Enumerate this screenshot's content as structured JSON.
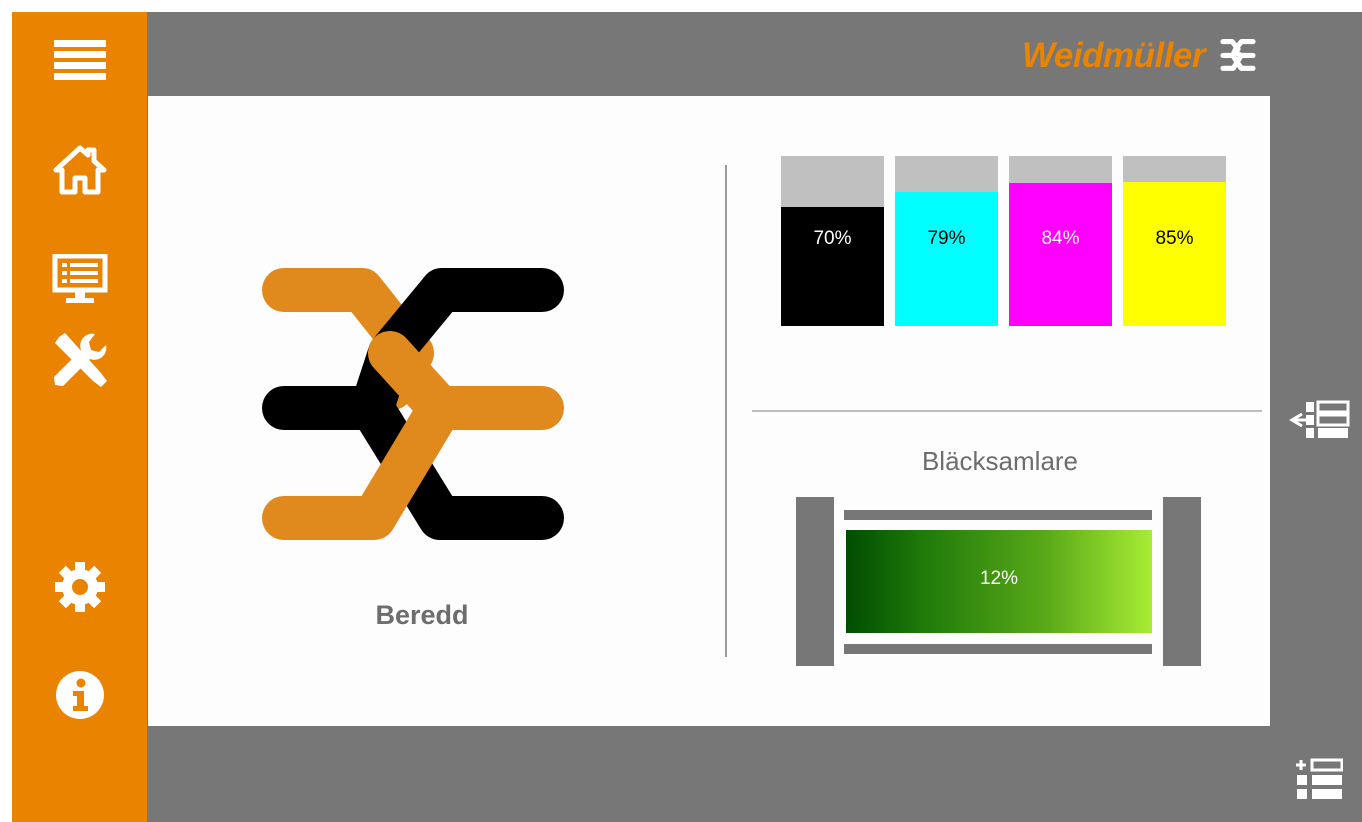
{
  "brand": {
    "name": "Weidmüller",
    "mark_icon": "weidmueller-logo-icon",
    "color": "#e98300"
  },
  "sidebar": {
    "color": "#e98300",
    "items": [
      {
        "name": "menu",
        "icon": "hamburger-menu-icon"
      },
      {
        "name": "home",
        "icon": "home-icon"
      },
      {
        "name": "display",
        "icon": "monitor-icon"
      },
      {
        "name": "tools",
        "icon": "tools-icon"
      },
      {
        "name": "settings",
        "icon": "gear-icon"
      },
      {
        "name": "info",
        "icon": "info-icon"
      }
    ]
  },
  "status": {
    "label": "Beredd",
    "icon": "weidmueller-logo-icon"
  },
  "ink_levels": [
    {
      "color": "#000000",
      "text_color": "#ffffff",
      "value": 0.7,
      "label": "70%"
    },
    {
      "color": "#00ffff",
      "text_color": "#000000",
      "value": 0.79,
      "label": "79%"
    },
    {
      "color": "#ff00ff",
      "text_color": "#ffffff",
      "value": 0.84,
      "label": "84%"
    },
    {
      "color": "#ffff00",
      "text_color": "#000000",
      "value": 0.85,
      "label": "85%"
    }
  ],
  "ink_collector": {
    "title": "Bläcksamlare",
    "value": 0.12,
    "label": "12%"
  },
  "right_bar": {
    "items": [
      {
        "name": "panel-in",
        "icon": "list-collapse-icon"
      },
      {
        "name": "job-list",
        "icon": "list-add-icon"
      }
    ]
  }
}
